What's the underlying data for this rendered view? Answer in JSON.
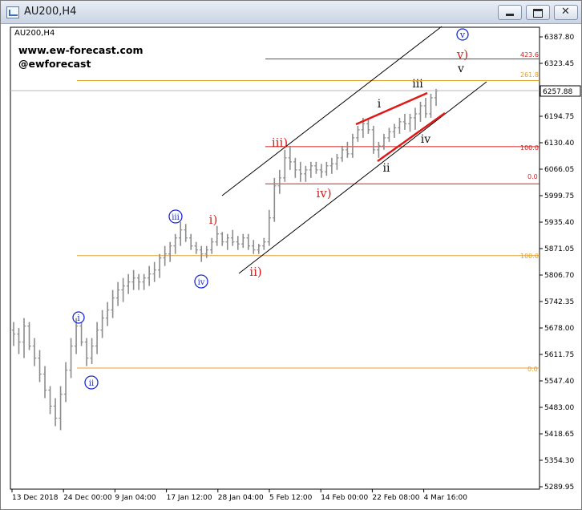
{
  "window": {
    "title": "AU200,H4"
  },
  "chart_data": {
    "type": "bar",
    "symbol_label": "AU200,H4",
    "watermark": [
      "www.ew-forecast.com",
      "@ewforecast"
    ],
    "last_price": "6257.88",
    "price_axis": {
      "ticks": [
        "6387.80",
        "6323.45",
        "6257.88",
        "6194.75",
        "6130.40",
        "6066.05",
        "5999.75",
        "5935.40",
        "5871.05",
        "5806.70",
        "5742.35",
        "5678.00",
        "5611.75",
        "5547.40",
        "5483.00",
        "5418.65",
        "5354.30",
        "5289.95"
      ]
    },
    "time_axis": {
      "ticks": [
        "13 Dec 2018",
        "24 Dec 00:00",
        "9 Jan 04:00",
        "17 Jan 12:00",
        "28 Jan 04:00",
        "5 Feb 12:00",
        "14 Feb 00:00",
        "22 Feb 08:00",
        "4 Mar 16:00"
      ]
    },
    "ohlc_bars": [
      [
        5660,
        5680,
        5620,
        5650
      ],
      [
        5650,
        5665,
        5600,
        5630
      ],
      [
        5630,
        5690,
        5590,
        5670
      ],
      [
        5670,
        5680,
        5610,
        5620
      ],
      [
        5620,
        5640,
        5570,
        5590
      ],
      [
        5590,
        5610,
        5530,
        5550
      ],
      [
        5550,
        5570,
        5490,
        5510
      ],
      [
        5510,
        5520,
        5450,
        5470
      ],
      [
        5470,
        5490,
        5420,
        5440
      ],
      [
        5440,
        5520,
        5410,
        5500
      ],
      [
        5500,
        5580,
        5480,
        5560
      ],
      [
        5560,
        5640,
        5540,
        5620
      ],
      [
        5620,
        5690,
        5600,
        5670
      ],
      [
        5670,
        5680,
        5620,
        5630
      ],
      [
        5630,
        5640,
        5570,
        5590
      ],
      [
        5590,
        5640,
        5575,
        5620
      ],
      [
        5620,
        5680,
        5600,
        5660
      ],
      [
        5660,
        5710,
        5640,
        5690
      ],
      [
        5690,
        5730,
        5670,
        5710
      ],
      [
        5710,
        5760,
        5690,
        5740
      ],
      [
        5740,
        5780,
        5720,
        5760
      ],
      [
        5760,
        5790,
        5730,
        5770
      ],
      [
        5770,
        5800,
        5750,
        5780
      ],
      [
        5780,
        5810,
        5760,
        5790
      ],
      [
        5790,
        5800,
        5760,
        5780
      ],
      [
        5780,
        5800,
        5760,
        5790
      ],
      [
        5790,
        5820,
        5770,
        5800
      ],
      [
        5800,
        5830,
        5780,
        5810
      ],
      [
        5810,
        5850,
        5790,
        5840
      ],
      [
        5840,
        5870,
        5820,
        5850
      ],
      [
        5850,
        5880,
        5830,
        5870
      ],
      [
        5870,
        5900,
        5850,
        5890
      ],
      [
        5890,
        5930,
        5870,
        5910
      ],
      [
        5910,
        5925,
        5880,
        5890
      ],
      [
        5890,
        5900,
        5860,
        5870
      ],
      [
        5870,
        5880,
        5850,
        5860
      ],
      [
        5860,
        5870,
        5830,
        5850
      ],
      [
        5850,
        5870,
        5840,
        5860
      ],
      [
        5860,
        5890,
        5850,
        5880
      ],
      [
        5880,
        5920,
        5870,
        5900
      ],
      [
        5900,
        5905,
        5870,
        5880
      ],
      [
        5880,
        5900,
        5860,
        5890
      ],
      [
        5890,
        5910,
        5870,
        5880
      ],
      [
        5880,
        5895,
        5860,
        5875
      ],
      [
        5875,
        5900,
        5865,
        5890
      ],
      [
        5890,
        5900,
        5860,
        5870
      ],
      [
        5870,
        5885,
        5850,
        5860
      ],
      [
        5860,
        5875,
        5850,
        5870
      ],
      [
        5870,
        5890,
        5860,
        5880
      ],
      [
        5880,
        5960,
        5870,
        5940
      ],
      [
        5940,
        6040,
        5930,
        6020
      ],
      [
        6020,
        6060,
        6000,
        6040
      ],
      [
        6040,
        6110,
        6030,
        6090
      ],
      [
        6090,
        6120,
        6060,
        6080
      ],
      [
        6080,
        6090,
        6040,
        6060
      ],
      [
        6060,
        6080,
        6030,
        6050
      ],
      [
        6050,
        6070,
        6030,
        6060
      ],
      [
        6060,
        6080,
        6040,
        6070
      ],
      [
        6070,
        6080,
        6050,
        6060
      ],
      [
        6060,
        6075,
        6040,
        6055
      ],
      [
        6055,
        6080,
        6045,
        6070
      ],
      [
        6070,
        6090,
        6050,
        6075
      ],
      [
        6075,
        6100,
        6060,
        6090
      ],
      [
        6090,
        6120,
        6080,
        6110
      ],
      [
        6110,
        6130,
        6090,
        6100
      ],
      [
        6100,
        6150,
        6090,
        6140
      ],
      [
        6140,
        6170,
        6130,
        6160
      ],
      [
        6160,
        6190,
        6140,
        6175
      ],
      [
        6175,
        6190,
        6150,
        6160
      ],
      [
        6160,
        6170,
        6100,
        6110
      ],
      [
        6110,
        6130,
        6090,
        6120
      ],
      [
        6120,
        6150,
        6110,
        6140
      ],
      [
        6140,
        6165,
        6130,
        6155
      ],
      [
        6155,
        6175,
        6140,
        6165
      ],
      [
        6165,
        6190,
        6150,
        6180
      ],
      [
        6180,
        6200,
        6160,
        6175
      ],
      [
        6175,
        6200,
        6155,
        6190
      ],
      [
        6190,
        6215,
        6160,
        6200
      ],
      [
        6200,
        6230,
        6180,
        6220
      ],
      [
        6220,
        6240,
        6190,
        6200
      ],
      [
        6200,
        6250,
        6190,
        6240
      ],
      [
        6240,
        6262,
        6220,
        6257
      ]
    ],
    "levels": [
      {
        "label": "423.6",
        "price": 6337,
        "color": "#d62020"
      },
      {
        "label": "261.8",
        "price": 6283,
        "color": "#e0a030"
      },
      {
        "label": "100.0",
        "price": 6118,
        "color": "#d62020"
      },
      {
        "label": "0.0",
        "price": 6025,
        "color": "#d62020"
      },
      {
        "label": "100.0",
        "price": 5846,
        "color": "#e0a030"
      },
      {
        "label": "0.0",
        "price": 5565,
        "color": "#e0a030"
      }
    ],
    "wave_labels": [
      {
        "text": "v",
        "color": "#1a2bd1",
        "circled": true
      },
      {
        "text": "v)",
        "color": "#d62020"
      },
      {
        "text": "v",
        "color": "#111111"
      },
      {
        "text": "iii",
        "color": "#111111"
      },
      {
        "text": "i",
        "color": "#111111"
      },
      {
        "text": "iii)",
        "color": "#d62020"
      },
      {
        "text": "iv",
        "color": "#111111"
      },
      {
        "text": "ii",
        "color": "#111111"
      },
      {
        "text": "iv)",
        "color": "#d62020"
      },
      {
        "text": "iii",
        "color": "#1a2bd1",
        "circled": true
      },
      {
        "text": "i)",
        "color": "#d62020"
      },
      {
        "text": "iv",
        "color": "#1a2bd1",
        "circled": true
      },
      {
        "text": "ii)",
        "color": "#d62020"
      },
      {
        "text": "i",
        "color": "#1a2bd1",
        "circled": true
      },
      {
        "text": "ii",
        "color": "#1a2bd1",
        "circled": true
      }
    ],
    "colors": {
      "bars": "#8c8c8c",
      "channel": "#000000",
      "wedge": "#e01818",
      "blue_labels": "#1a2bd1",
      "red_labels": "#d62020"
    }
  }
}
